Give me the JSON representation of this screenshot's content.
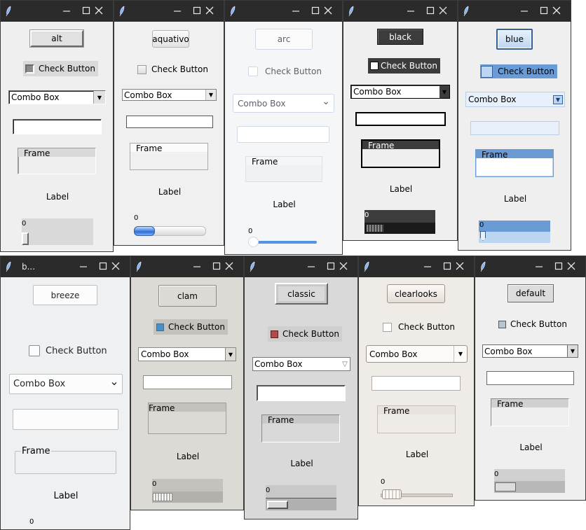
{
  "colors": {
    "titlebar": "#2b2b2b",
    "titlebar_text": "#e6e6e6",
    "blue_accent": "#6a9bd5",
    "breeze_accent": "#3daee9",
    "arc_accent": "#5294e2",
    "clam_check": "#4a90c8",
    "classic_check": "#b24b4b"
  },
  "icons": {
    "app": "feather-icon",
    "minimize": "minimize-icon",
    "maximize": "maximize-icon",
    "close": "close-icon"
  },
  "windows": [
    {
      "title": "",
      "theme": "alt",
      "button": "alt",
      "check": "Check Button",
      "combo": "Combo Box",
      "frame": "Frame",
      "label": "Label",
      "scale": "0",
      "scale_value": 0
    },
    {
      "title": "",
      "theme": "aquativo",
      "button": "aquativo",
      "check": "Check Button",
      "combo": "Combo Box",
      "frame": "Frame",
      "label": "Label",
      "scale": "0",
      "scale_value": 0
    },
    {
      "title": "",
      "theme": "arc",
      "button": "arc",
      "check": "Check Button",
      "combo": "Combo Box",
      "frame": "Frame",
      "label": "Label",
      "scale": "0",
      "scale_value": 0
    },
    {
      "title": "",
      "theme": "black",
      "button": "black",
      "check": "Check Button",
      "combo": "Combo Box",
      "frame": "Frame",
      "label": "Label",
      "scale": "0",
      "scale_value": 0
    },
    {
      "title": "",
      "theme": "blue",
      "button": "blue",
      "check": "Check Button",
      "combo": "Combo Box",
      "frame": "Frame",
      "label": "Label",
      "scale": "0",
      "scale_value": 0
    },
    {
      "title": "b...",
      "theme": "breeze",
      "button": "breeze",
      "check": "Check Button",
      "combo": "Combo Box",
      "frame": "Frame",
      "label": "Label",
      "scale": "0",
      "scale_value": 0
    },
    {
      "title": "",
      "theme": "clam",
      "button": "clam",
      "check": "Check Button",
      "combo": "Combo Box",
      "frame": "Frame",
      "label": "Label",
      "scale": "0",
      "scale_value": 0
    },
    {
      "title": "",
      "theme": "classic",
      "button": "classic",
      "check": "Check Button",
      "combo": "Combo Box",
      "frame": "Frame",
      "label": "Label",
      "scale": "0",
      "scale_value": 0
    },
    {
      "title": "",
      "theme": "clearlooks",
      "button": "clearlooks",
      "check": "Check Button",
      "combo": "Combo Box",
      "frame": "Frame",
      "label": "Label",
      "scale": "0",
      "scale_value": 0
    },
    {
      "title": "",
      "theme": "default",
      "button": "default",
      "check": "Check Button",
      "combo": "Combo Box",
      "frame": "Frame",
      "label": "Label",
      "scale": "0",
      "scale_value": 0
    }
  ]
}
